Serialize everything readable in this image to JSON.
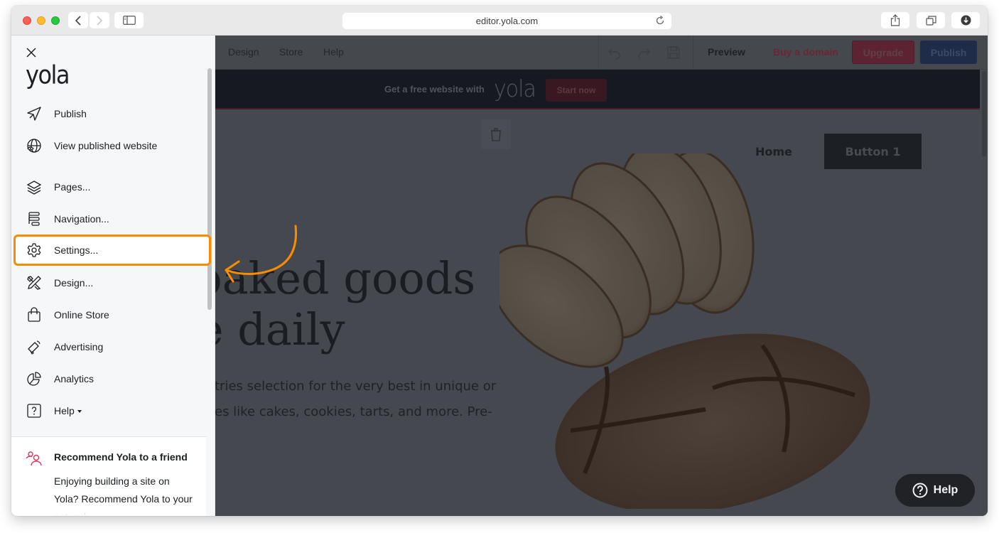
{
  "browser": {
    "url": "editor.yola.com",
    "icons": [
      "chevron-left-icon",
      "chevron-right-icon",
      "sidebar-icon",
      "reload-icon",
      "share-icon",
      "tabs-icon",
      "download-icon"
    ]
  },
  "editor_bar": {
    "menu": [
      "Design",
      "Store",
      "Help"
    ],
    "preview": "Preview",
    "buy_domain": "Buy a domain",
    "upgrade": "Upgrade",
    "publish": "Publish",
    "icons": [
      "undo-icon",
      "redo-icon",
      "save-icon"
    ]
  },
  "banner": {
    "text": "Get a free website with",
    "logo": "yola",
    "cta": "Start now"
  },
  "site": {
    "nav_home": "Home",
    "nav_button": "Button 1",
    "hero_title_line1": "baked goods",
    "hero_title_line2": "le daily",
    "hero_body_line1": "tries selection for the very best in unique or",
    "hero_body_line2": "es like cakes, cookies, tarts, and more. Pre-"
  },
  "help_fab": {
    "label": "Help"
  },
  "sidebar": {
    "logo": "yola",
    "items": [
      {
        "label": "Publish",
        "icon": "rocket-icon"
      },
      {
        "label": "View published website",
        "icon": "globe-eye-icon"
      },
      {
        "label": "Pages...",
        "icon": "layers-icon"
      },
      {
        "label": "Navigation...",
        "icon": "navigation-icon"
      },
      {
        "label": "Settings...",
        "icon": "gear-icon",
        "highlighted": true
      },
      {
        "label": "Design...",
        "icon": "design-tools-icon"
      },
      {
        "label": "Online Store",
        "icon": "shopping-bag-icon"
      },
      {
        "label": "Advertising",
        "icon": "megaphone-icon"
      },
      {
        "label": "Analytics",
        "icon": "pie-chart-icon"
      },
      {
        "label": "Help",
        "icon": "question-icon",
        "dropdown": true
      }
    ],
    "footer": {
      "title": "Recommend Yola to a friend",
      "body": "Enjoying building a site on Yola? Recommend Yola to your network."
    }
  },
  "colors": {
    "highlight": "#fb8c00",
    "recommend_icon": "#e0365a"
  }
}
